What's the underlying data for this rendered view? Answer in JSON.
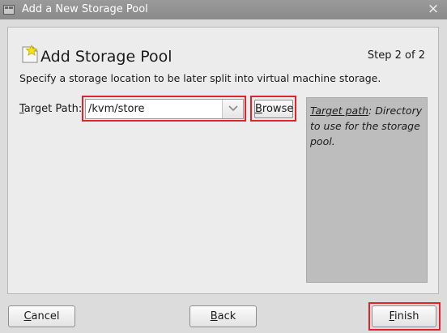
{
  "window": {
    "title": "Add a New Storage Pool",
    "close_glyph": "×"
  },
  "header": {
    "title": "Add Storage Pool",
    "step": "Step 2 of 2",
    "subtitle": "Specify a storage location to be later split into virtual machine storage."
  },
  "form": {
    "target_path_mnemonic": "T",
    "target_path_rest": "arget Path:",
    "target_path_value": "/kvm/store",
    "browse_mnemonic": "B",
    "browse_rest": "rowse"
  },
  "help": {
    "term": "Target path",
    "description": ": Directory to use for the storage pool."
  },
  "buttons": {
    "cancel_mnemonic": "C",
    "cancel_rest": "ancel",
    "back_mnemonic": "B",
    "back_rest": "ack",
    "finish_mnemonic": "F",
    "finish_rest": "inish"
  },
  "colors": {
    "highlight": "#e0242c",
    "help_background": "#bdbdbd"
  },
  "icons": {
    "app": "app-window-icon",
    "header": "storage-pool-star-icon",
    "dropdown": "chevron-down-icon",
    "close": "close-icon"
  }
}
